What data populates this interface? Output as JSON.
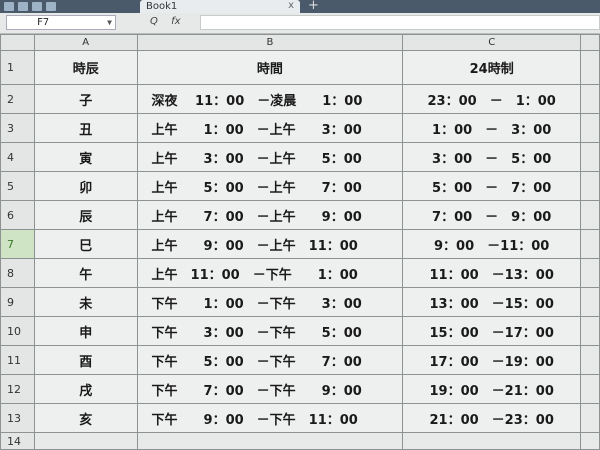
{
  "app": {
    "tab_title": "Book1",
    "close_glyph": "x",
    "add_glyph": "+"
  },
  "formula_bar": {
    "cell_ref": "F7",
    "dropdown_glyph": "▼",
    "search_glyph": "Q",
    "fx_label": "fx",
    "formula": ""
  },
  "columns": [
    "A",
    "B",
    "C"
  ],
  "row_numbers": [
    "1",
    "2",
    "3",
    "4",
    "5",
    "6",
    "7",
    "8",
    "9",
    "10",
    "11",
    "12",
    "13",
    "14"
  ],
  "header_row": {
    "a": "時辰",
    "b": "時間",
    "c": "24時制"
  },
  "rows": [
    {
      "a": "子",
      "b": "深夜　 11：00　－凌晨　　1：00",
      "c": "23：00　－　1：00"
    },
    {
      "a": "丑",
      "b": "上午　　1：00　－上午　　3：00",
      "c": "1：00　－　3：00"
    },
    {
      "a": "寅",
      "b": "上午　　3：00　－上午　　5：00",
      "c": "3：00　－　5：00"
    },
    {
      "a": "卯",
      "b": "上午　　5：00　－上午　　7：00",
      "c": "5：00　－　7：00"
    },
    {
      "a": "辰",
      "b": "上午　　7：00　－上午　　9：00",
      "c": "7：00　－　9：00"
    },
    {
      "a": "巳",
      "b": "上午　　9：00　－上午　11：00",
      "c": "9：00　－11：00"
    },
    {
      "a": "午",
      "b": "上午　11：00　－下午　　1：00",
      "c": "11：00　－13：00"
    },
    {
      "a": "未",
      "b": "下午　　1：00　－下午　　3：00",
      "c": "13：00　－15：00"
    },
    {
      "a": "申",
      "b": "下午　　3：00　－下午　　5：00",
      "c": "15：00　－17：00"
    },
    {
      "a": "酉",
      "b": "下午　　5：00　－下午　　7：00",
      "c": "17：00　－19：00"
    },
    {
      "a": "戌",
      "b": "下午　　7：00　－下午　　9：00",
      "c": "19：00　－21：00"
    },
    {
      "a": "亥",
      "b": "下午　　9：00　－下午　11：00",
      "c": "21：00　－23：00"
    }
  ],
  "active_row": "7"
}
